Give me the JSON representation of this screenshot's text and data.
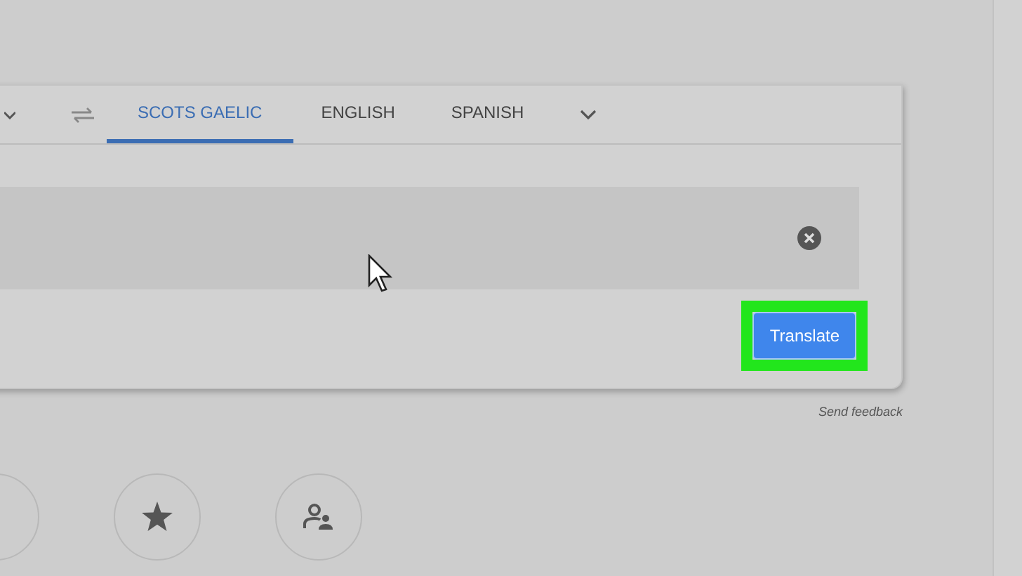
{
  "language_tabs": [
    {
      "label": "SCOTS GAELIC",
      "selected": true
    },
    {
      "label": "ENGLISH",
      "selected": false
    },
    {
      "label": "SPANISH",
      "selected": false
    }
  ],
  "translate_button": {
    "label": "Translate",
    "highlighted": true
  },
  "feedback_link": "Send feedback"
}
